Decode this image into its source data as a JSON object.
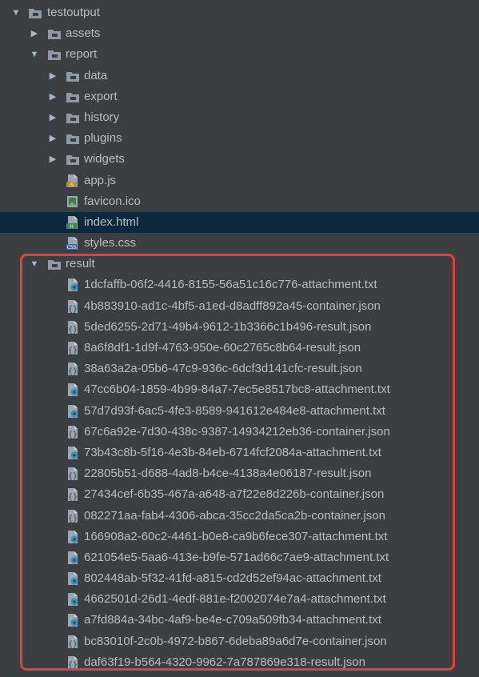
{
  "tree": {
    "root": {
      "label": "testoutput",
      "icon": "folder-icon",
      "expanded": true
    },
    "assets": {
      "label": "assets",
      "icon": "folder-icon",
      "expanded": false
    },
    "report": {
      "label": "report",
      "icon": "folder-icon",
      "expanded": true
    },
    "report_children": [
      {
        "label": "data",
        "icon": "folder-icon",
        "type": "folder"
      },
      {
        "label": "export",
        "icon": "folder-icon",
        "type": "folder"
      },
      {
        "label": "history",
        "icon": "folder-icon",
        "type": "folder"
      },
      {
        "label": "plugins",
        "icon": "folder-icon",
        "type": "folder"
      },
      {
        "label": "widgets",
        "icon": "folder-icon",
        "type": "folder"
      },
      {
        "label": "app.js",
        "icon": "js-file-icon",
        "type": "file",
        "badge": "JS"
      },
      {
        "label": "favicon.ico",
        "icon": "image-file-icon",
        "type": "file"
      },
      {
        "label": "index.html",
        "icon": "html-file-icon",
        "type": "file",
        "badge": "H",
        "selected": true
      },
      {
        "label": "styles.css",
        "icon": "css-file-icon",
        "type": "file",
        "badge": "CSS"
      }
    ],
    "result": {
      "label": "result",
      "icon": "folder-icon",
      "expanded": true
    },
    "result_files": [
      {
        "label": "1dcfaffb-06f2-4416-8155-56a51c16c776-attachment.txt",
        "icon": "text-file-icon"
      },
      {
        "label": "4b883910-ad1c-4bf5-a1ed-d8adff892a45-container.json",
        "icon": "json-file-icon"
      },
      {
        "label": "5ded6255-2d71-49b4-9612-1b3366c1b496-result.json",
        "icon": "json-file-icon"
      },
      {
        "label": "8a6f8df1-1d9f-4763-950e-60c2765c8b64-result.json",
        "icon": "json-file-icon"
      },
      {
        "label": "38a63a2a-05b6-47c9-936c-6dcf3d141cfc-result.json",
        "icon": "json-file-icon"
      },
      {
        "label": "47cc6b04-1859-4b99-84a7-7ec5e8517bc8-attachment.txt",
        "icon": "text-file-icon"
      },
      {
        "label": "57d7d93f-6ac5-4fe3-8589-941612e484e8-attachment.txt",
        "icon": "text-file-icon"
      },
      {
        "label": "67c6a92e-7d30-438c-9387-14934212eb36-container.json",
        "icon": "json-file-icon"
      },
      {
        "label": "73b43c8b-5f16-4e3b-84eb-6714fcf2084a-attachment.txt",
        "icon": "text-file-icon"
      },
      {
        "label": "22805b51-d688-4ad8-b4ce-4138a4e06187-result.json",
        "icon": "json-file-icon"
      },
      {
        "label": "27434cef-6b35-467a-a648-a7f22e8d226b-container.json",
        "icon": "json-file-icon"
      },
      {
        "label": "082271aa-fab4-4306-abca-35cc2da5ca2b-container.json",
        "icon": "json-file-icon"
      },
      {
        "label": "166908a2-60c2-4461-b0e8-ca9b6fece307-attachment.txt",
        "icon": "text-file-icon"
      },
      {
        "label": "621054e5-5aa6-413e-b9fe-571ad66c7ae9-attachment.txt",
        "icon": "text-file-icon"
      },
      {
        "label": "802448ab-5f32-41fd-a815-cd2d52ef94ac-attachment.txt",
        "icon": "text-file-icon"
      },
      {
        "label": "4662501d-26d1-4edf-881e-f2002074e7a4-attachment.txt",
        "icon": "text-file-icon"
      },
      {
        "label": "a7fd884a-34bc-4af9-be4e-c709a509fb34-attachment.txt",
        "icon": "text-file-icon"
      },
      {
        "label": "bc83010f-2c0b-4972-b867-6deba89a6d7e-container.json",
        "icon": "json-file-icon"
      },
      {
        "label": "daf63f19-b564-4320-9962-7a787869e318-result.json",
        "icon": "json-file-icon"
      }
    ]
  },
  "colors": {
    "background": "#3c3f41",
    "selection": "#0d293e",
    "text": "#bbbbbb",
    "folder": "#8f9aa3",
    "highlight_border": "#e0413e",
    "gear": "#3592c4"
  }
}
